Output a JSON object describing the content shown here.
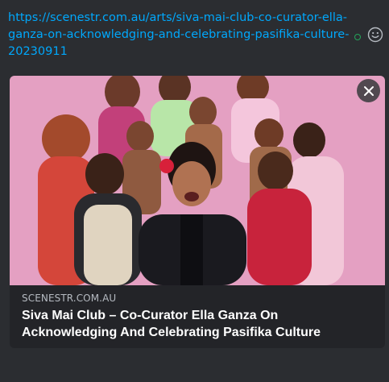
{
  "message": {
    "link_text": "https://scenestr.com.au/arts/siva-mai-club-co-curator-ella-ganza-on-acknowledging-and-celebrating-pasifika-culture-20230911"
  },
  "embed": {
    "provider": "SCENESTR.COM.AU",
    "title": "Siva Mai Club – Co-Curator Ella Ganza On Acknowledging And Celebrating Pasifika Culture",
    "image_background": "#e8a6c6",
    "close_icon": "close-icon"
  },
  "colors": {
    "background": "#2b2d31",
    "embed_background": "#232428",
    "link": "#00a8fc",
    "status_dot": "#23a55a"
  }
}
